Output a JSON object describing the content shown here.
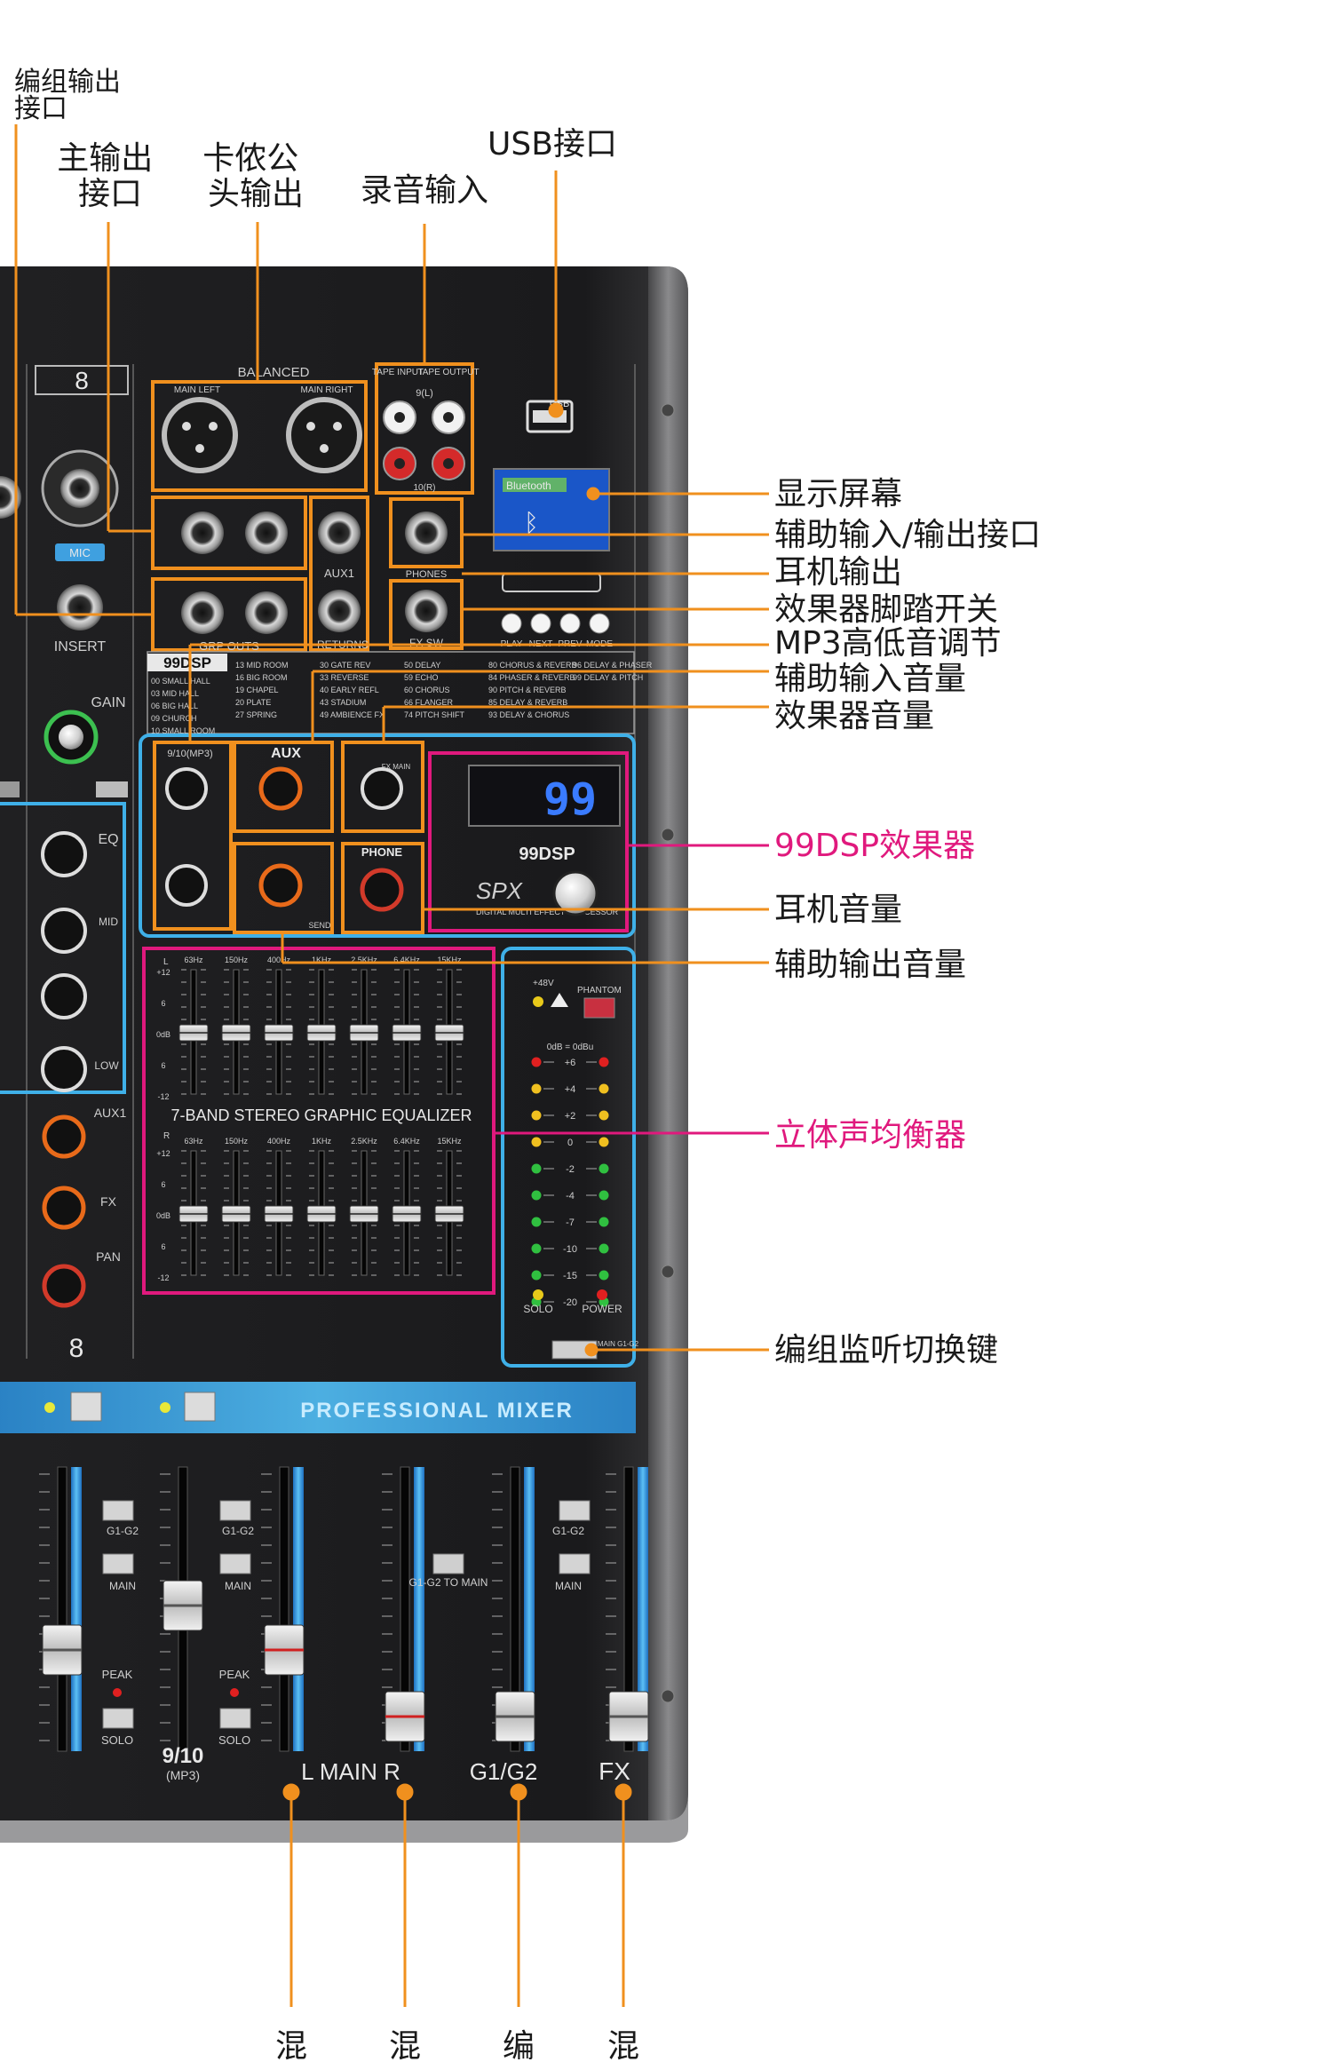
{
  "callouts_top": {
    "group_output": "编组输出\n接口",
    "main_output": "主输出\n接口",
    "xlr_output": "卡侬公\n头输出",
    "tape_input": "录音输入",
    "usb_port": "USB接口"
  },
  "callouts_right": [
    {
      "text": "显示屏幕",
      "highlight": false
    },
    {
      "text": "辅助输入/输出接口",
      "highlight": false
    },
    {
      "text": "耳机输出",
      "highlight": false
    },
    {
      "text": "效果器脚踏开关",
      "highlight": false
    },
    {
      "text": "MP3高低音调节",
      "highlight": false
    },
    {
      "text": "辅助输入音量",
      "highlight": false
    },
    {
      "text": "效果器音量",
      "highlight": false
    },
    {
      "text": "99DSP效果器",
      "highlight": true
    },
    {
      "text": "耳机音量",
      "highlight": false
    },
    {
      "text": "辅助输出音量",
      "highlight": false
    },
    {
      "text": "立体声均衡器",
      "highlight": true
    },
    {
      "text": "编组监听切换键",
      "highlight": false
    }
  ],
  "callouts_bottom": [
    "混",
    "混",
    "编",
    "混"
  ],
  "colors": {
    "orange": "#f0901e",
    "pink": "#e0197d",
    "cyan": "#3fb0e8",
    "panel": "#1c1c1e",
    "panel_edge": "#8a8a8a",
    "lcd_blue": "#1a56c8",
    "dsp_digits": "#3a7bff",
    "knob_orange": "#e86a1a",
    "knob_red": "#d23a2a"
  },
  "panel": {
    "channel_number": "8",
    "channel_number_bottom": "8",
    "balanced": "BALANCED",
    "main_left": "MAIN LEFT",
    "main_right": "MAIN RIGHT",
    "tape_input": "TAPE\nINPUT",
    "tape_output": "TAPE\nOUTPUT",
    "tape_channel": "9(L)",
    "tape_channel_r": "10(R)",
    "mic_label": "MIC",
    "insert_label": "INSERT",
    "gain_label": "GAIN",
    "aux1_label": "AUX1",
    "returns_label": "RETURNS",
    "grp_outs": "GRP OUTS",
    "fx_sw": "FX SW",
    "phones": "PHONES",
    "usb_tag": "USB",
    "player_buttons": [
      "PLAY",
      "NEXT",
      "PREV",
      "MODE"
    ],
    "lcd_text": "Bluetooth",
    "dsp_title": "99DSP",
    "dsp_display": "99",
    "dsp_brand": "SPX",
    "dsp_subtitle": "DIGITAL MULTI\nEFFECT PROCESSOR",
    "dsp_label": "99DSP",
    "knob_9_10": "9/10(MP3)",
    "knob_aux": "AUX",
    "knob_fx": "FX MAIN",
    "knob_phone": "PHONE",
    "knob_send": "SEND",
    "eq_title": "7-BAND STEREO GRAPHIC EQUALIZER",
    "eq_freqs": [
      "63Hz",
      "150Hz",
      "400Hz",
      "1KHz",
      "2.5KHz",
      "6.4KHz",
      "15KHz"
    ],
    "eq_scale": [
      "+12",
      "6",
      "0dB",
      "6",
      "-12"
    ],
    "eq_l": "L",
    "eq_r": "R",
    "meter_levels": [
      "+6",
      "+4",
      "+2",
      "0",
      "-2",
      "-4",
      "-7",
      "-10",
      "-15",
      "-20"
    ],
    "meter_top": "0dB = 0dBu",
    "phantom": "PHANTOM",
    "p48": "+48V",
    "solo": "SOLO",
    "power": "POWER",
    "main_switch": "MAIN\nG1-G2",
    "professional_mixer": "PROFESSIONAL MIXER",
    "eq_knob_label": "EQ",
    "mid_label": "MID",
    "low_label": "LOW",
    "aux1_knob": "AUX1",
    "fx_knob": "FX",
    "pan_knob": "PAN",
    "g1g2": "G1-G2",
    "main": "MAIN",
    "peak": "PEAK",
    "solo_btn": "SOLO",
    "g1g2_to_main": "G1-G2\nTO\nMAIN",
    "fader_9_10": "9/10",
    "fader_9_10_sub": "(MP3)",
    "fader_main": "L MAIN R",
    "fader_g1g2": "G1/G2",
    "fader_fx": "FX",
    "dsp_presets": [
      "00 SMALL HALL",
      "03 MID HALL",
      "06 BIG HALL",
      "09 CHURCH",
      "10 SMALL ROOM",
      "13 MID ROOM",
      "16 BIG ROOM",
      "19 CHAPEL",
      "20 PLATE",
      "27 SPRING",
      "30 GATE REV",
      "33 REVERSE",
      "40 EARLY REFL",
      "43 STADIUM",
      "49 AMBIENCE FX",
      "50 DELAY",
      "59 ECHO",
      "60 CHORUS",
      "66 FLANGER",
      "74 PITCH SHIFT",
      "80 CHORUS & REVERB",
      "84 PHASER & REVERB",
      "90 PITCH & REVERB",
      "85 DELAY & REVERB",
      "93 DELAY & CHORUS",
      "96 DELAY & PHASER",
      "99 DELAY & PITCH"
    ]
  }
}
